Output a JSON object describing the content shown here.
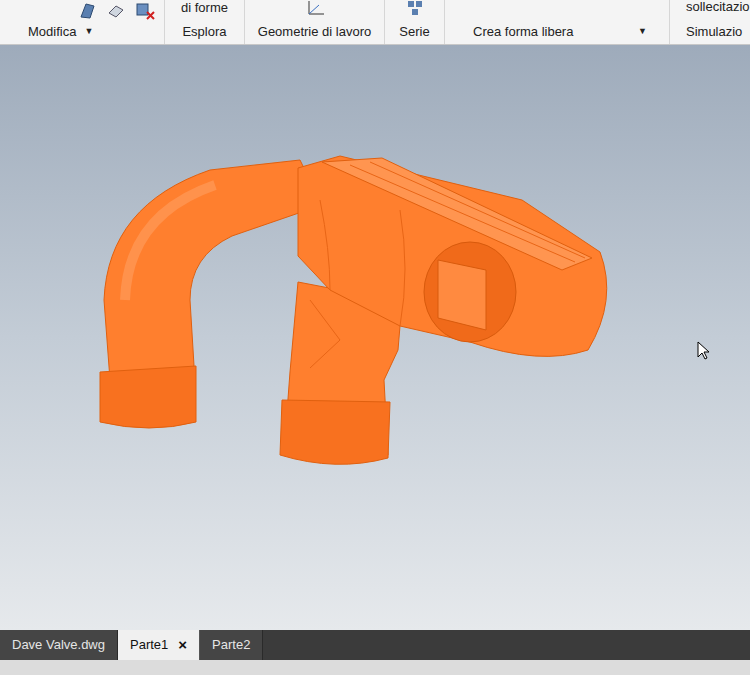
{
  "ribbon": {
    "panels": [
      {
        "label": "Modifica",
        "dropdown": "▼"
      },
      {
        "label": "Esplora",
        "top_text": "di forme"
      },
      {
        "label": "Geometrie di lavoro"
      },
      {
        "label": "Serie"
      },
      {
        "label": "Crea forma libera",
        "dropdown": "▼"
      },
      {
        "label": "Simulazio",
        "top_text": "sollecitazio"
      }
    ]
  },
  "document_tabs": [
    {
      "label": "Dave Valve.dwg",
      "selected": false
    },
    {
      "label": "Parte1",
      "selected": true,
      "close": "×"
    },
    {
      "label": "Parte2",
      "selected": false
    }
  ]
}
